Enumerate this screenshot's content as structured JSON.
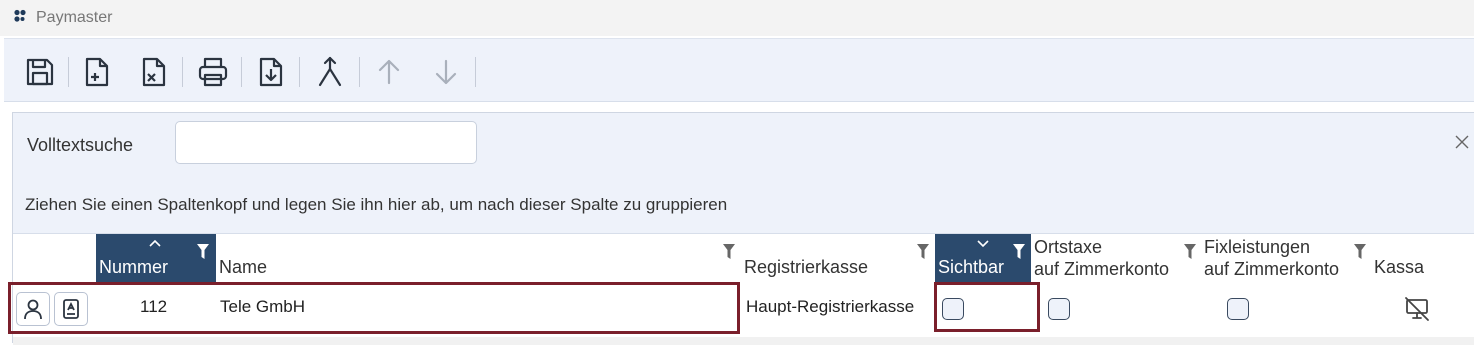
{
  "app": {
    "title": "Paymaster",
    "logo_icon": "app-logo-icon"
  },
  "toolbar": {
    "buttons": [
      {
        "name": "save-button",
        "icon": "save-icon",
        "enabled": true
      },
      {
        "name": "new-document-button",
        "icon": "new-document-icon",
        "enabled": true
      },
      {
        "name": "delete-document-button",
        "icon": "delete-document-icon",
        "enabled": true
      },
      {
        "name": "print-button",
        "icon": "printer-icon",
        "enabled": true
      },
      {
        "name": "download-button",
        "icon": "download-icon",
        "enabled": true
      },
      {
        "name": "merge-button",
        "icon": "merge-icon",
        "enabled": true
      },
      {
        "name": "move-up-button",
        "icon": "arrow-up-icon",
        "enabled": false
      },
      {
        "name": "move-down-button",
        "icon": "arrow-down-icon",
        "enabled": false
      }
    ]
  },
  "search": {
    "label": "Volltextsuche",
    "value": "",
    "placeholder": ""
  },
  "group_hint": "Ziehen Sie einen Spaltenkopf und legen Sie ihn hier ab, um nach dieser Spalte zu gruppieren",
  "columns": {
    "nummer": "Nummer",
    "name": "Name",
    "registrierkasse": "Registrierkasse",
    "sichtbar": "Sichtbar",
    "ortstaxe_line1": "Ortstaxe",
    "ortstaxe_line2": "auf Zimmerkonto",
    "fixleistungen_line1": "Fixleistungen",
    "fixleistungen_line2": "auf Zimmerkonto",
    "kassa": "Kassa"
  },
  "rows": [
    {
      "nummer": "112",
      "name": "Tele GmbH",
      "registrierkasse": "Haupt-Registrierkasse",
      "sichtbar": false,
      "ortstaxe": false,
      "fixleistungen": false,
      "kassa_icon": "monitor-off-icon"
    }
  ],
  "colors": {
    "header_active": "#2b4a6d",
    "highlight": "#7a1f2b",
    "toolbar_bg": "#eef2fa"
  }
}
